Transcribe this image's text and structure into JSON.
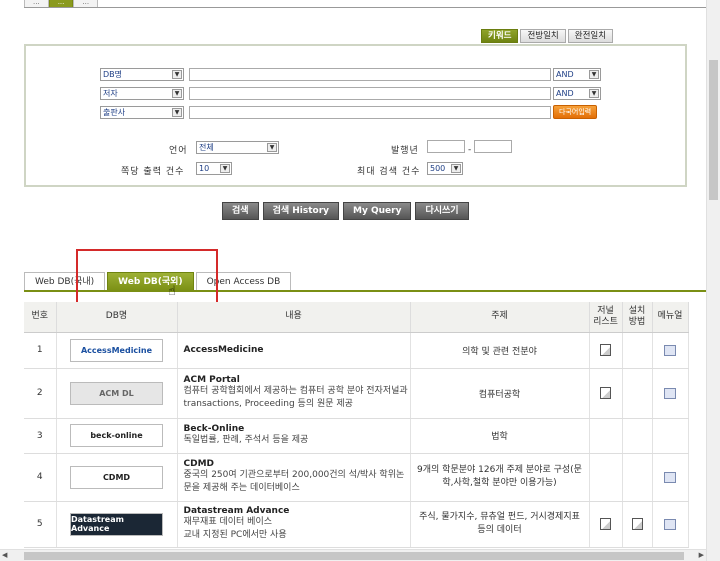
{
  "top_tabs": [
    "···",
    "···",
    "···"
  ],
  "mode_tabs": [
    {
      "label": "키워드",
      "active": true
    },
    {
      "label": "전방일치",
      "active": false
    },
    {
      "label": "완전일치",
      "active": false
    }
  ],
  "search_rows": [
    {
      "field": "DB명",
      "op": "AND"
    },
    {
      "field": "저자",
      "op": "AND"
    },
    {
      "field": "출판사"
    }
  ],
  "multilang_button": "다국어입력",
  "lang_label": "언어",
  "lang_value": "전체",
  "year_label": "발행년",
  "year_separator": "-",
  "per_page_label": "쪽당 출력 건수",
  "per_page_value": "10",
  "max_label": "최대 검색 건수",
  "max_value": "500",
  "actions": [
    "검색",
    "검색 History",
    "My Query",
    "다시쓰기"
  ],
  "db_tabs": [
    {
      "label": "Web DB(국내)",
      "active": false
    },
    {
      "label": "Web DB(국외)",
      "active": true
    },
    {
      "label": "Open Access DB",
      "active": false
    }
  ],
  "table": {
    "headers": [
      "번호",
      "DB명",
      "내용",
      "주제",
      "저널\n리스트",
      "설치\n방법",
      "메뉴얼"
    ],
    "rows": [
      {
        "no": "1",
        "logo": "AccessMedicine",
        "name": "AccessMedicine",
        "desc": "",
        "subject": "의학 및 관련 전분야"
      },
      {
        "no": "2",
        "logo": "ACM DL",
        "name": "ACM Portal",
        "desc": "컴퓨터 공학협회에서 제공하는 컴퓨터 공학 분야 전자저널과 transactions, Proceeding 등의 원문 제공",
        "subject": "컴퓨터공학"
      },
      {
        "no": "3",
        "logo": "beck-online",
        "name": "Beck-Online",
        "desc": "독일법률, 판례, 주석서 등을 제공",
        "subject": "법학"
      },
      {
        "no": "4",
        "logo": "CDMD",
        "name": "CDMD",
        "desc": "중국의 250여 기관으로부터 200,000건의 석/박사 학위논문을 제공해 주는 데이터베이스",
        "subject": "9개의 학문분야 126개 주제 분야로 구성(문학,사학,철학 분야만 이용가능)"
      },
      {
        "no": "5",
        "logo": "Datastream Advance",
        "name": "Datastream Advance",
        "desc": "재무재표 데이터 베이스\n교내 지정된 PC에서만 사용",
        "subject": "주식, 물가지수, 뮤츄얼 펀드, 거시경제지표 등의 데이터"
      }
    ]
  }
}
